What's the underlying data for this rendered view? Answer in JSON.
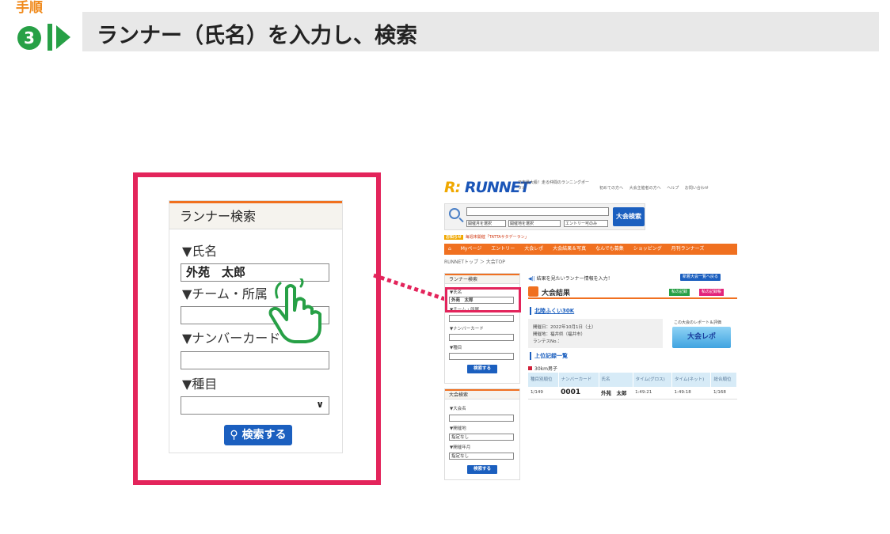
{
  "step": {
    "tag": "手順",
    "number": "3",
    "title": "ランナー（氏名）を入力し、検索"
  },
  "zoom": {
    "header": "ランナー検索",
    "name_label": "▼氏名",
    "name_value": "外苑　太郎",
    "team_label": "▼チーム・所属",
    "card_label": "▼ナンバーカード",
    "event_label": "▼種目",
    "search_button": "検索する"
  },
  "mini": {
    "logo": "RUNNET",
    "tagline": "日本最大級！走る仲間のランニングポータル",
    "toplinks": [
      "初めての方へ",
      "大会主催者の方へ",
      "ヘルプ",
      "お問い合わせ"
    ],
    "search": {
      "month_select": "開催月を選択",
      "area_select": "開催地を選択",
      "entry_check": "エントリー可のみ",
      "button": "大会検索"
    },
    "news_badge": "お知らせ",
    "news_text": "毎週末開催「TATTAサタデーラン」",
    "nav": [
      "Myページ",
      "エントリー",
      "大会レポ",
      "大会結果＆写真",
      "なんでも募集",
      "ショッピング",
      "月刊ランナーズ"
    ],
    "breadcrumb": "RUNNETトップ ＞ 大会TOP",
    "runner_search": {
      "header": "ランナー検索",
      "name_label": "▼氏名",
      "name_value": "外苑　太郎",
      "team_label": "▼チーム・所属",
      "card_label": "▼ナンバーカード",
      "event_label": "▼種目",
      "button": "検索する"
    },
    "race_search": {
      "header": "大会検索",
      "name_label": "▼大会名",
      "place_label": "▼開催地",
      "place_value": "指定なし",
      "month_label": "▼開催年月",
      "month_value": "指定なし",
      "button": "検索する"
    },
    "prompt": "結果を見たいランナー情報を入力！",
    "new_races_button": "新着大会一覧へ戻る",
    "results_title": "大会結果",
    "my_records_button": "私の記録",
    "friend_records_button": "私の記録帳",
    "race_name": "北陸ふくい30K",
    "date_line": "開催日：2022年10月1日（土）",
    "venue_line": "開催地：福井県（福井市）",
    "rantes_line": "ランテスNo.：",
    "report_text": "この大会のレポート＆評価",
    "banner_text": "大会レポ",
    "top_records": "上位記録一覧",
    "category": "30km男子",
    "table": {
      "headers": [
        "種目別順位",
        "ナンバーカード",
        "氏名",
        "タイム(グロス)",
        "タイム(ネット)",
        "総合順位"
      ],
      "rows": [
        [
          "1/149",
          "0001",
          "外苑　太郎",
          "1:49:21",
          "1:49:18",
          "1/168"
        ]
      ]
    }
  }
}
